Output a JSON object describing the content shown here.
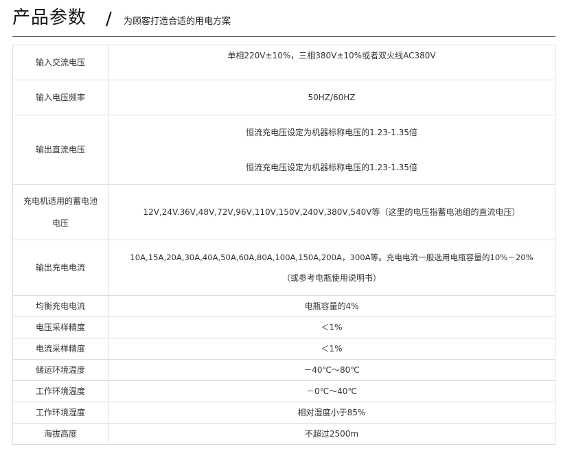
{
  "header": {
    "title": "产品参数",
    "slash": "/",
    "subtitle": "为顾客打造合适的用电方案"
  },
  "colors": {
    "border": "#dcdcdc",
    "text": "#333333",
    "rule": "#333333"
  },
  "specs": [
    {
      "label": [
        "输入交流电压"
      ],
      "value": [
        "单相220V±10%，三相380V±10%或者双火线AC380V"
      ]
    },
    {
      "label": [
        "输入电压频率"
      ],
      "value": [
        "50HZ/60HZ"
      ]
    },
    {
      "label": [
        "输出直流电压"
      ],
      "value": [
        "恒流充电压设定为机器标称电压的1.23-1.35倍",
        "恒流充电压设定为机器标称电压的1.23-1.35倍"
      ]
    },
    {
      "label": [
        "充电机适用的蓄电池",
        "电压"
      ],
      "value": [
        "12V,24V.36V,48V,72V,96V,110V,150V,240V,380V,540V等（这里的电压指蓄电池组的直流电压）"
      ]
    },
    {
      "label": [
        "输出充电电流"
      ],
      "value": [
        "10A,15A,20A,30A,40A,50A,60A,80A,100A,150A,200A，300A等。充电电流一般选用电瓶容量的10%－20%",
        "（或参考电瓶使用说明书）"
      ]
    },
    {
      "label": [
        "均衡充电电流"
      ],
      "value": [
        "电瓶容量的4%"
      ]
    },
    {
      "label": [
        "电压采样精度"
      ],
      "value": [
        "＜1%"
      ]
    },
    {
      "label": [
        "电流采样精度"
      ],
      "value": [
        "＜1%"
      ]
    },
    {
      "label": [
        "储运环境温度"
      ],
      "value": [
        "－40℃～80℃"
      ]
    },
    {
      "label": [
        "工作环境温度"
      ],
      "value": [
        "－0℃～40℃"
      ]
    },
    {
      "label": [
        "工作环境湿度"
      ],
      "value": [
        "相对湿度小于85%"
      ]
    },
    {
      "label": [
        "海拔高度"
      ],
      "value": [
        "不超过2500m"
      ]
    }
  ]
}
